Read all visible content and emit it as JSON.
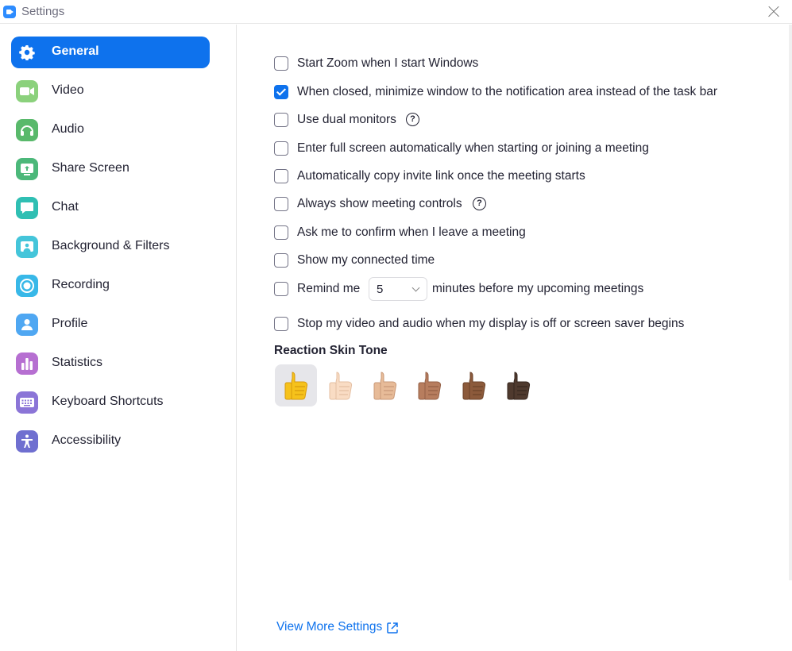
{
  "window": {
    "title": "Settings"
  },
  "sidebar": {
    "items": [
      {
        "label": "General",
        "icon": "gear-icon",
        "color": "#0e72ed",
        "active": true
      },
      {
        "label": "Video",
        "icon": "video-camera-icon",
        "color": "#8bd17c"
      },
      {
        "label": "Audio",
        "icon": "headphones-icon",
        "color": "#59b96b"
      },
      {
        "label": "Share Screen",
        "icon": "share-screen-icon",
        "color": "#4cb87a"
      },
      {
        "label": "Chat",
        "icon": "chat-bubble-icon",
        "color": "#2fbfb3"
      },
      {
        "label": "Background & Filters",
        "icon": "background-icon",
        "color": "#44c5da"
      },
      {
        "label": "Recording",
        "icon": "record-icon",
        "color": "#38b8e8"
      },
      {
        "label": "Profile",
        "icon": "person-icon",
        "color": "#4fa7f2"
      },
      {
        "label": "Statistics",
        "icon": "bar-chart-icon",
        "color": "#b66fd1"
      },
      {
        "label": "Keyboard Shortcuts",
        "icon": "keyboard-icon",
        "color": "#8b75d7"
      },
      {
        "label": "Accessibility",
        "icon": "accessibility-icon",
        "color": "#6f6fd0"
      }
    ]
  },
  "general": {
    "options": [
      {
        "label": "Start Zoom when I start Windows",
        "checked": false
      },
      {
        "label": "When closed, minimize window to the notification area instead of the task bar",
        "checked": true
      },
      {
        "label": "Use dual monitors",
        "checked": false,
        "help": true
      },
      {
        "label": "Enter full screen automatically when starting or joining a meeting",
        "checked": false
      },
      {
        "label": "Automatically copy invite link once the meeting starts",
        "checked": false
      },
      {
        "label": "Always show meeting controls",
        "checked": false,
        "help": true
      },
      {
        "label": "Ask me to confirm when I leave a meeting",
        "checked": false
      },
      {
        "label": "Show my connected time",
        "checked": false
      }
    ],
    "remind": {
      "prefix": "Remind me",
      "value": "5",
      "suffix": "minutes before my upcoming meetings",
      "checked": false
    },
    "stop_video": {
      "label": "Stop my video and audio when my display is off or screen saver begins",
      "checked": false
    },
    "help_glyph": "?",
    "reaction": {
      "title": "Reaction Skin Tone",
      "tones": [
        {
          "name": "default",
          "color": "#f6c21b",
          "shade": "#d79a0e",
          "selected": true
        },
        {
          "name": "light",
          "color": "#f9dcc4",
          "shade": "#e4bfa2"
        },
        {
          "name": "medium-light",
          "color": "#e7bb98",
          "shade": "#c99877"
        },
        {
          "name": "medium",
          "color": "#b77d5e",
          "shade": "#946046"
        },
        {
          "name": "medium-dark",
          "color": "#8c5a3b",
          "shade": "#6c4329"
        },
        {
          "name": "dark",
          "color": "#4f3a2e",
          "shade": "#36271e"
        }
      ]
    },
    "view_more": "View More Settings"
  }
}
